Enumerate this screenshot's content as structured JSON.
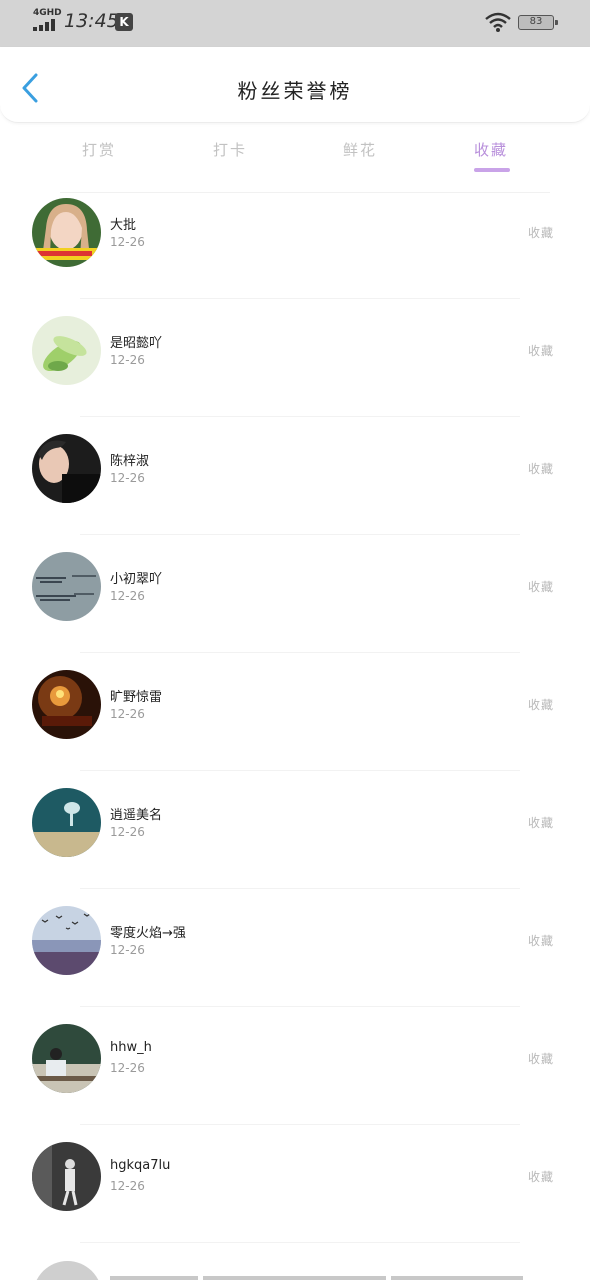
{
  "status_bar": {
    "network": "4GHD",
    "time": "13:45",
    "app_badge": "K",
    "battery": "83"
  },
  "header": {
    "title": "粉丝荣誉榜"
  },
  "tabs": [
    {
      "label": "打赏",
      "active": false
    },
    {
      "label": "打卡",
      "active": false
    },
    {
      "label": "鲜花",
      "active": false
    },
    {
      "label": "收藏",
      "active": true
    }
  ],
  "colors": {
    "accent": "#b88fdb",
    "back_arrow": "#3a9fe0",
    "status_bar_bg": "#d4d4d4"
  },
  "list": [
    {
      "name": "大批",
      "date": "12-26",
      "action": "收藏",
      "avatar": "girl-photo"
    },
    {
      "name": "是昭懿吖",
      "date": "12-26",
      "action": "收藏",
      "avatar": "green-plant"
    },
    {
      "name": "陈梓淑",
      "date": "12-26",
      "action": "收藏",
      "avatar": "boy-portrait"
    },
    {
      "name": "小初翠吖",
      "date": "12-26",
      "action": "收藏",
      "avatar": "handwriting"
    },
    {
      "name": "旷野惊雷",
      "date": "12-26",
      "action": "收藏",
      "avatar": "candle-light"
    },
    {
      "name": "逍遥美名",
      "date": "12-26",
      "action": "收藏",
      "avatar": "teal-glass"
    },
    {
      "name": "零度火焰→强",
      "date": "12-26",
      "action": "收藏",
      "avatar": "birds-sea"
    },
    {
      "name": "hhw_h",
      "date": "12-26",
      "action": "收藏",
      "avatar": "classroom"
    },
    {
      "name": "hgkqa7lu",
      "date": "12-26",
      "action": "收藏",
      "avatar": "bw-figure"
    }
  ]
}
